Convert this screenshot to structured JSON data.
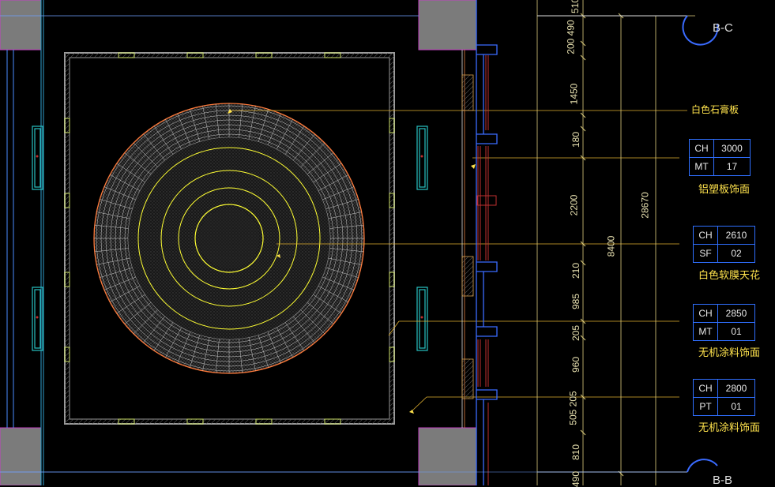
{
  "labels": {
    "callout_top": "白色石膏板",
    "grid_bc": "B-C",
    "grid_bb": "B-B"
  },
  "tags": [
    {
      "k1": "CH",
      "v1": "3000",
      "k2": "MT",
      "v2": "17",
      "caption": "铝塑板饰面"
    },
    {
      "k1": "CH",
      "v1": "2610",
      "k2": "SF",
      "v2": "02",
      "caption": "白色软膜天花"
    },
    {
      "k1": "CH",
      "v1": "2850",
      "k2": "MT",
      "v2": "01",
      "caption": "无机涂料饰面"
    },
    {
      "k1": "CH",
      "v1": "2800",
      "k2": "PT",
      "v2": "01",
      "caption": "无机涂料饰面"
    }
  ],
  "dims": {
    "d510": "510",
    "d200_490": "200 490",
    "d1450": "1450",
    "d180": "180",
    "d2200": "2200",
    "d210": "210",
    "d985": "985",
    "d205a": "205",
    "d960": "960",
    "d505_205": "505 205",
    "d810": "810",
    "d490": "490",
    "d8400": "8400",
    "d28670": "28670"
  }
}
